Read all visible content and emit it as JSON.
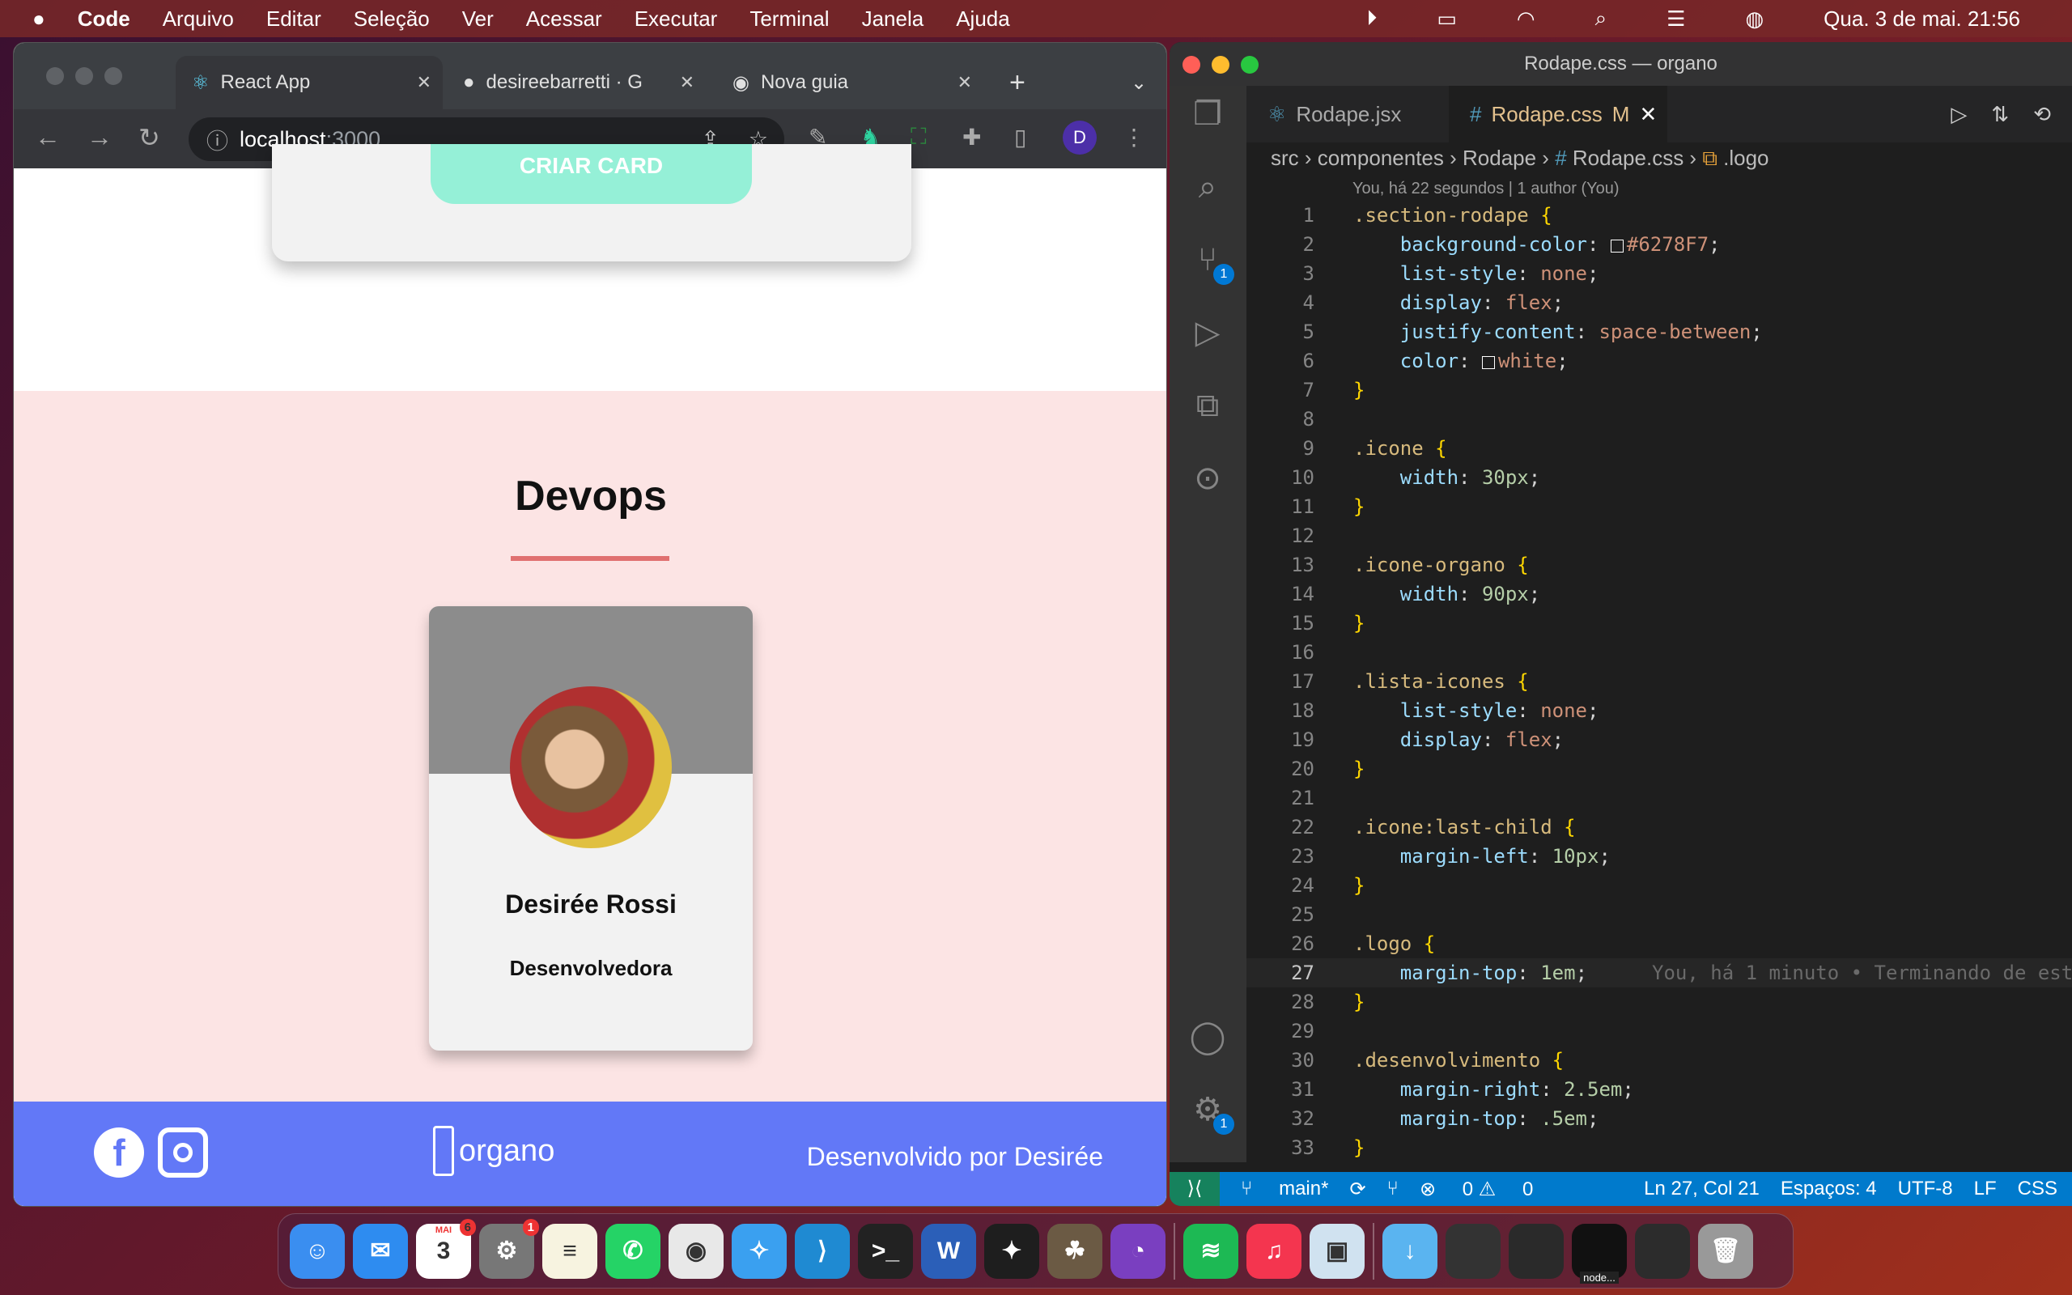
{
  "menubar": {
    "app": "Code",
    "items": [
      "Arquivo",
      "Editar",
      "Seleção",
      "Ver",
      "Acessar",
      "Executar",
      "Terminal",
      "Janela",
      "Ajuda"
    ],
    "clock": "Qua. 3 de mai.  21:56"
  },
  "browser": {
    "tabs": [
      {
        "label": "React App",
        "icon": "react-icon"
      },
      {
        "label": "desireebarretti · G",
        "icon": "github-icon"
      },
      {
        "label": "Nova guia",
        "icon": "chrome-icon"
      }
    ],
    "url_host": "localhost",
    "url_port": ":3000",
    "profile": "D",
    "page": {
      "create_button": "CRIAR CARD",
      "team_title": "Devops",
      "team_color": "#e07070",
      "card": {
        "name": "Desirée Rossi",
        "role": "Desenvolvedora"
      },
      "footer": {
        "logo_text": "organo",
        "credit": "Desenvolvido por Desirée",
        "color": "#6278F7"
      }
    }
  },
  "vscode": {
    "title": "Rodape.css — organo",
    "tabs": [
      {
        "label": "Rodape.jsx"
      },
      {
        "label": "Rodape.css",
        "status": "M"
      }
    ],
    "breadcrumb": [
      "src",
      "componentes",
      "Rodape",
      "Rodape.css",
      ".logo"
    ],
    "codelens": "You, há 22 segundos | 1 author (You)",
    "current_line": 27,
    "blame": "You, há 1 minuto • Terminando de est",
    "lines": [
      [
        [
          ".section-rodape",
          "selector"
        ],
        [
          " ",
          ""
        ],
        [
          "{",
          "brace"
        ]
      ],
      [
        [
          "    background-color",
          "property"
        ],
        [
          ": ",
          "punc"
        ],
        [
          "#SW#6278F7",
          ""
        ],
        [
          "#6278F7",
          "value"
        ],
        [
          ";",
          "punc"
        ]
      ],
      [
        [
          "    list-style",
          "property"
        ],
        [
          ": ",
          "punc"
        ],
        [
          "none",
          "value"
        ],
        [
          ";",
          "punc"
        ]
      ],
      [
        [
          "    display",
          "property"
        ],
        [
          ": ",
          "punc"
        ],
        [
          "flex",
          "value"
        ],
        [
          ";",
          "punc"
        ]
      ],
      [
        [
          "    justify-content",
          "property"
        ],
        [
          ": ",
          "punc"
        ],
        [
          "space-between",
          "value"
        ],
        [
          ";",
          "punc"
        ]
      ],
      [
        [
          "    color",
          "property"
        ],
        [
          ": ",
          "punc"
        ],
        [
          "#SW#ffffff",
          ""
        ],
        [
          "white",
          "value"
        ],
        [
          ";",
          "punc"
        ]
      ],
      [
        [
          "}",
          "brace"
        ]
      ],
      [],
      [
        [
          ".icone",
          "selector"
        ],
        [
          " ",
          ""
        ],
        [
          "{",
          "brace"
        ]
      ],
      [
        [
          "    width",
          "property"
        ],
        [
          ": ",
          "punc"
        ],
        [
          "30px",
          "number"
        ],
        [
          ";",
          "punc"
        ]
      ],
      [
        [
          "}",
          "brace"
        ]
      ],
      [],
      [
        [
          ".icone-organo",
          "selector"
        ],
        [
          " ",
          ""
        ],
        [
          "{",
          "brace"
        ]
      ],
      [
        [
          "    width",
          "property"
        ],
        [
          ": ",
          "punc"
        ],
        [
          "90px",
          "number"
        ],
        [
          ";",
          "punc"
        ]
      ],
      [
        [
          "}",
          "brace"
        ]
      ],
      [],
      [
        [
          ".lista-icones",
          "selector"
        ],
        [
          " ",
          ""
        ],
        [
          "{",
          "brace"
        ]
      ],
      [
        [
          "    list-style",
          "property"
        ],
        [
          ": ",
          "punc"
        ],
        [
          "none",
          "value"
        ],
        [
          ";",
          "punc"
        ]
      ],
      [
        [
          "    display",
          "property"
        ],
        [
          ": ",
          "punc"
        ],
        [
          "flex",
          "value"
        ],
        [
          ";",
          "punc"
        ]
      ],
      [
        [
          "}",
          "brace"
        ]
      ],
      [],
      [
        [
          ".icone:last-child",
          "selector"
        ],
        [
          " ",
          ""
        ],
        [
          "{",
          "brace"
        ]
      ],
      [
        [
          "    margin-left",
          "property"
        ],
        [
          ": ",
          "punc"
        ],
        [
          "10px",
          "number"
        ],
        [
          ";",
          "punc"
        ]
      ],
      [
        [
          "}",
          "brace"
        ]
      ],
      [],
      [
        [
          ".logo",
          "selector"
        ],
        [
          " ",
          ""
        ],
        [
          "{",
          "brace"
        ]
      ],
      [
        [
          "    margin-top",
          "property"
        ],
        [
          ": ",
          "punc"
        ],
        [
          "1em",
          "number"
        ],
        [
          ";",
          "punc"
        ]
      ],
      [
        [
          "}",
          "brace"
        ]
      ],
      [],
      [
        [
          ".desenvolvimento",
          "selector"
        ],
        [
          " ",
          ""
        ],
        [
          "{",
          "brace"
        ]
      ],
      [
        [
          "    margin-right",
          "property"
        ],
        [
          ": ",
          "punc"
        ],
        [
          "2.5em",
          "number"
        ],
        [
          ";",
          "punc"
        ]
      ],
      [
        [
          "    margin-top",
          "property"
        ],
        [
          ": ",
          "punc"
        ],
        [
          ".5em",
          "number"
        ],
        [
          ";",
          "punc"
        ]
      ],
      [
        [
          "}",
          "brace"
        ]
      ]
    ],
    "status": {
      "branch": "main*",
      "problems": "0",
      "warnings": "0",
      "position": "Ln 27, Col 21",
      "spaces": "Espaços: 4",
      "encoding": "UTF-8",
      "eol": "LF",
      "language": "CSS"
    },
    "badges": {
      "scm": "1",
      "settings": "1"
    }
  },
  "dock": [
    {
      "name": "finder",
      "color": "#3a8ef0",
      "glyph": "☺"
    },
    {
      "name": "mail",
      "color": "#2e8cf0",
      "glyph": "✉"
    },
    {
      "name": "calendar",
      "color": "#ffffff",
      "glyph": "3",
      "badge": "6",
      "month": "MAI"
    },
    {
      "name": "system-settings",
      "color": "#777",
      "glyph": "⚙",
      "badge": "1"
    },
    {
      "name": "notes",
      "color": "#f7f3e0",
      "glyph": "≡"
    },
    {
      "name": "whatsapp",
      "color": "#25d366",
      "glyph": "✆"
    },
    {
      "name": "chrome",
      "color": "#e8e8e8",
      "glyph": "◉"
    },
    {
      "name": "safari",
      "color": "#3aa0f0",
      "glyph": "✧"
    },
    {
      "name": "vscode",
      "color": "#1f8ad2",
      "glyph": "⟩"
    },
    {
      "name": "terminal",
      "color": "#222",
      "glyph": ">_"
    },
    {
      "name": "word",
      "color": "#2b5fb8",
      "glyph": "W"
    },
    {
      "name": "figma",
      "color": "#1e1e1e",
      "glyph": "✦"
    },
    {
      "name": "gimp",
      "color": "#6b5a44",
      "glyph": "☘"
    },
    {
      "name": "github-desktop",
      "color": "#7a3fc0",
      "glyph": "◔"
    },
    {
      "name": "spotify",
      "color": "#1db954",
      "glyph": "≋"
    },
    {
      "name": "music",
      "color": "#f4354f",
      "glyph": "♫"
    },
    {
      "name": "preview",
      "color": "#d0e2f0",
      "glyph": "▣"
    },
    {
      "name": "downloads",
      "color": "#5ab4f0",
      "glyph": "↓"
    },
    {
      "name": "window-1",
      "color": "#333",
      "glyph": ""
    },
    {
      "name": "window-2",
      "color": "#2a2a2a",
      "glyph": ""
    },
    {
      "name": "terminal-node",
      "color": "#111",
      "glyph": "",
      "label": "node..."
    },
    {
      "name": "window-3",
      "color": "#2c2c2c",
      "glyph": ""
    },
    {
      "name": "trash",
      "color": "#999",
      "glyph": "🗑"
    }
  ]
}
